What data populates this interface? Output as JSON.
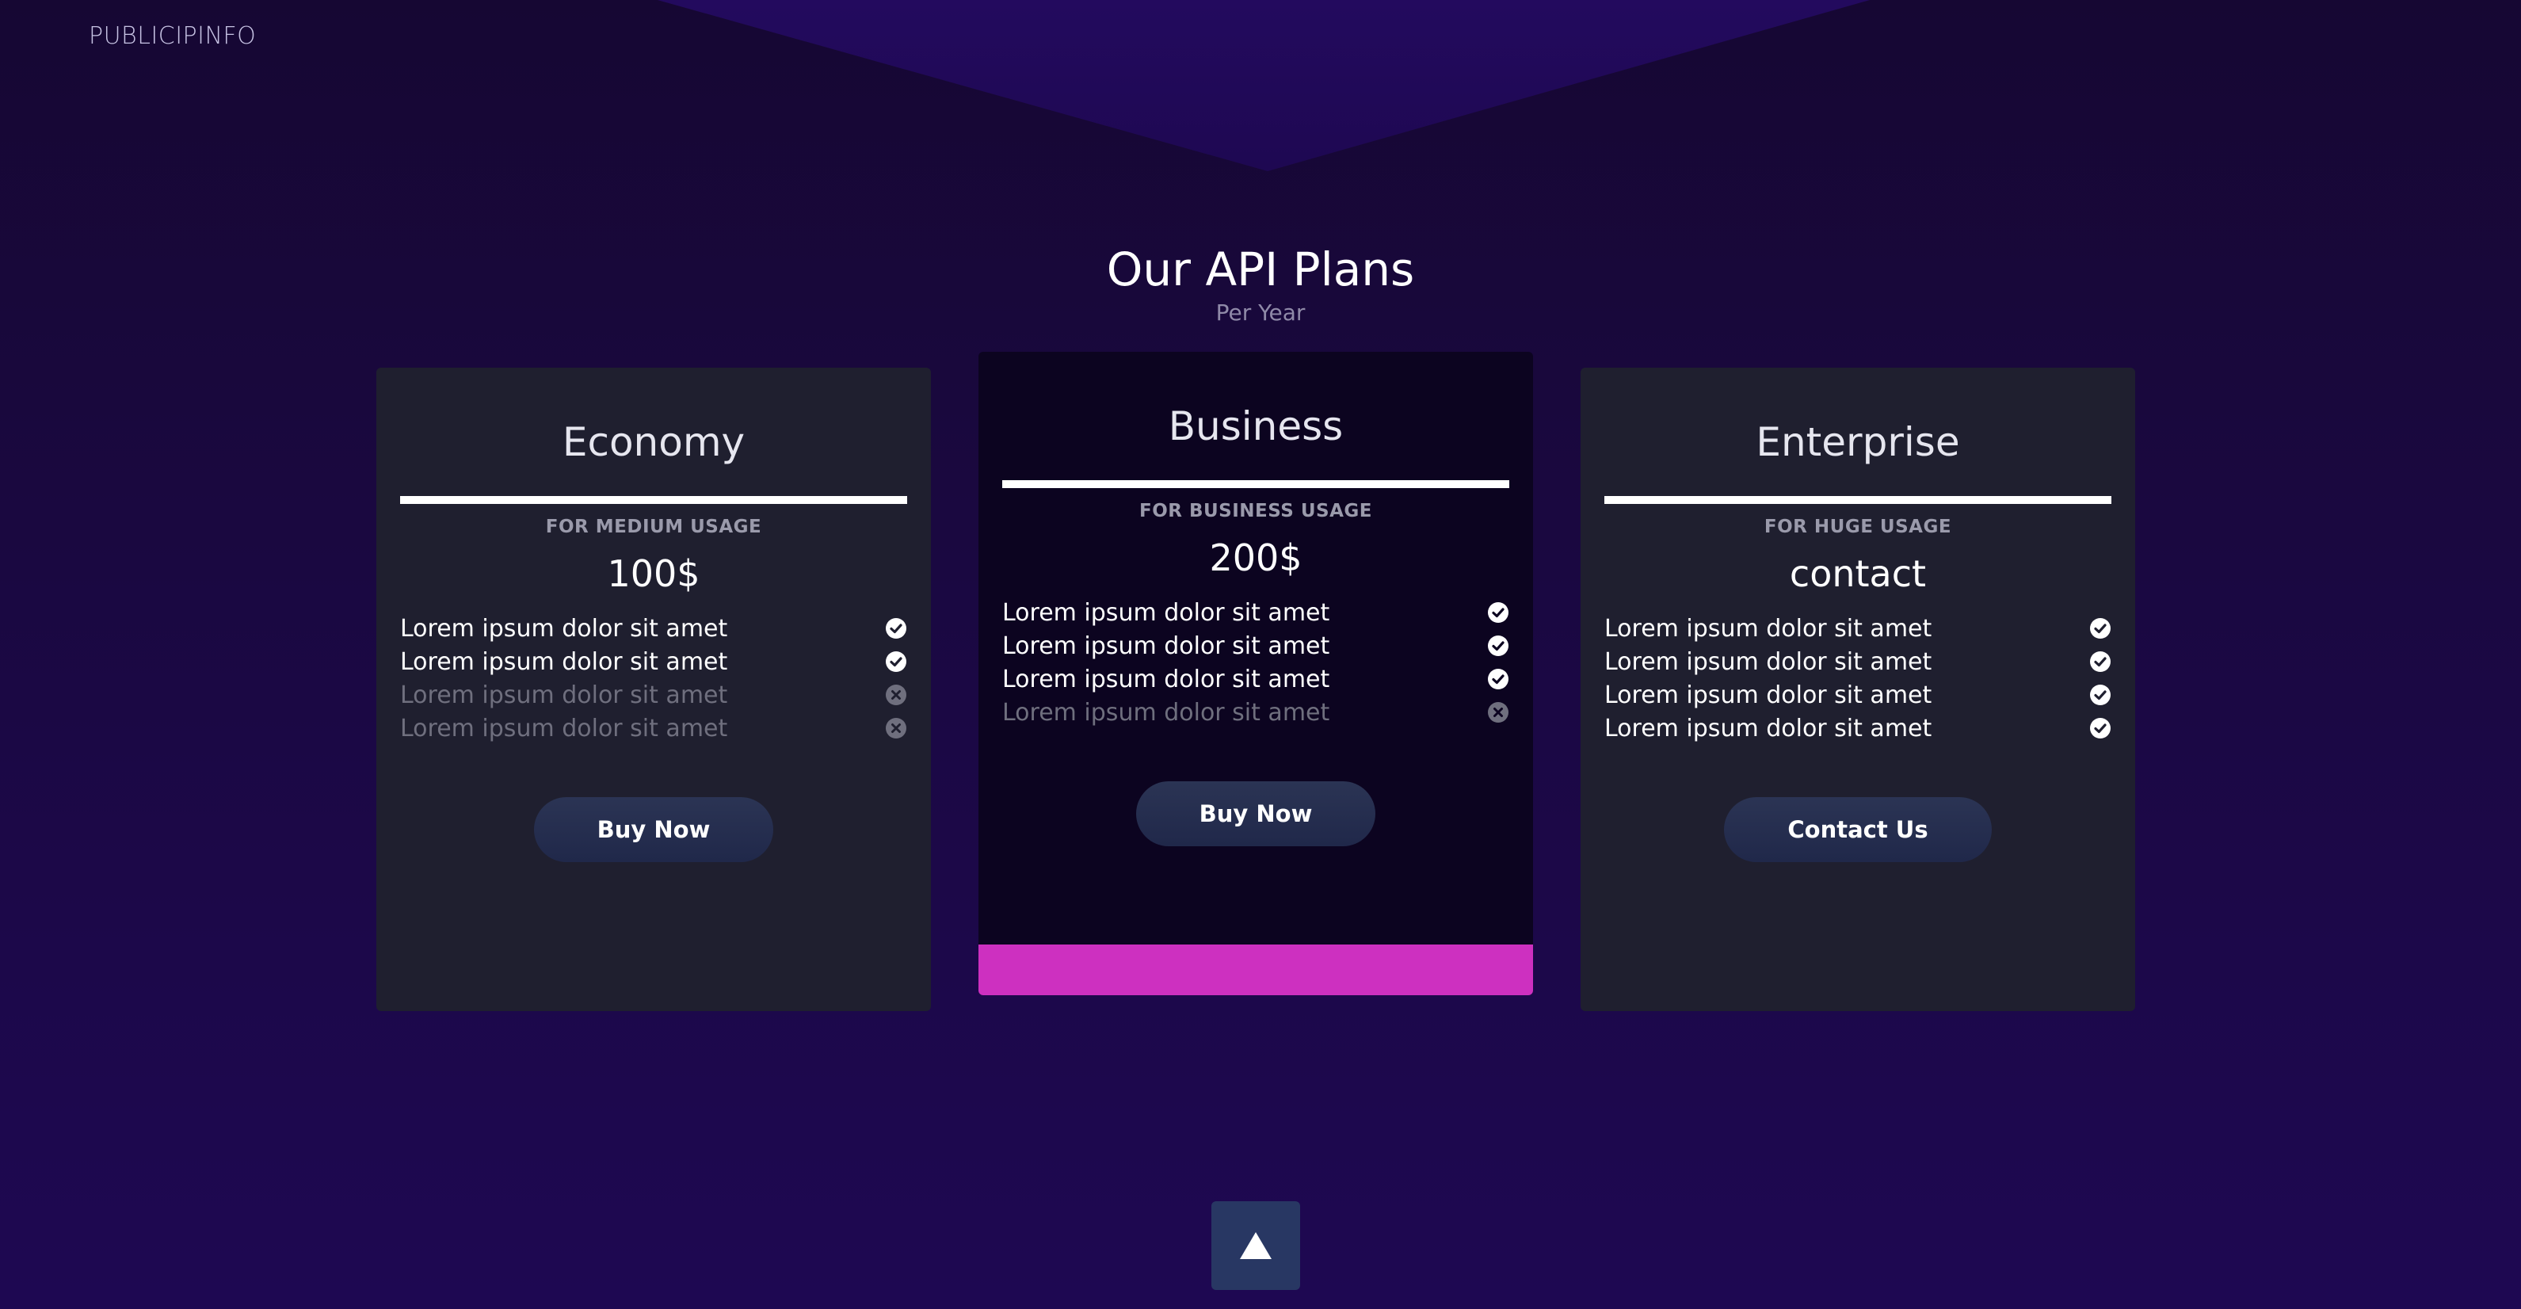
{
  "brand": "PUBLICIPINFO",
  "header": {
    "title": "Our API Plans",
    "subtitle": "Per Year"
  },
  "colors": {
    "background": "#1a0840",
    "card": "#1f1f2f",
    "featured_card": "#0c0420",
    "accent": "#cd30c0",
    "button": "#283763"
  },
  "plans": [
    {
      "name": "Economy",
      "usage": "FOR MEDIUM USAGE",
      "price": "100$",
      "button": "Buy Now",
      "featured": false,
      "features": [
        {
          "text": "Lorem ipsum dolor sit amet",
          "included": true,
          "icon": "check-circle-icon"
        },
        {
          "text": "Lorem ipsum dolor sit amet",
          "included": true,
          "icon": "check-circle-icon"
        },
        {
          "text": "Lorem ipsum dolor sit amet",
          "included": false,
          "icon": "x-circle-icon"
        },
        {
          "text": "Lorem ipsum dolor sit amet",
          "included": false,
          "icon": "x-circle-icon"
        }
      ]
    },
    {
      "name": "Business",
      "usage": "FOR BUSINESS USAGE",
      "price": "200$",
      "button": "Buy Now",
      "featured": true,
      "features": [
        {
          "text": "Lorem ipsum dolor sit amet",
          "included": true,
          "icon": "check-circle-icon"
        },
        {
          "text": "Lorem ipsum dolor sit amet",
          "included": true,
          "icon": "check-circle-icon"
        },
        {
          "text": "Lorem ipsum dolor sit amet",
          "included": true,
          "icon": "check-circle-icon"
        },
        {
          "text": "Lorem ipsum dolor sit amet",
          "included": false,
          "icon": "x-circle-icon"
        }
      ]
    },
    {
      "name": "Enterprise",
      "usage": "FOR HUGE USAGE",
      "price": "contact",
      "button": "Contact Us",
      "featured": false,
      "features": [
        {
          "text": "Lorem ipsum dolor sit amet",
          "included": true,
          "icon": "check-circle-icon"
        },
        {
          "text": "Lorem ipsum dolor sit amet",
          "included": true,
          "icon": "check-circle-icon"
        },
        {
          "text": "Lorem ipsum dolor sit amet",
          "included": true,
          "icon": "check-circle-icon"
        },
        {
          "text": "Lorem ipsum dolor sit amet",
          "included": true,
          "icon": "check-circle-icon"
        }
      ]
    }
  ],
  "scroll_top": {
    "icon": "arrow-up-icon"
  }
}
